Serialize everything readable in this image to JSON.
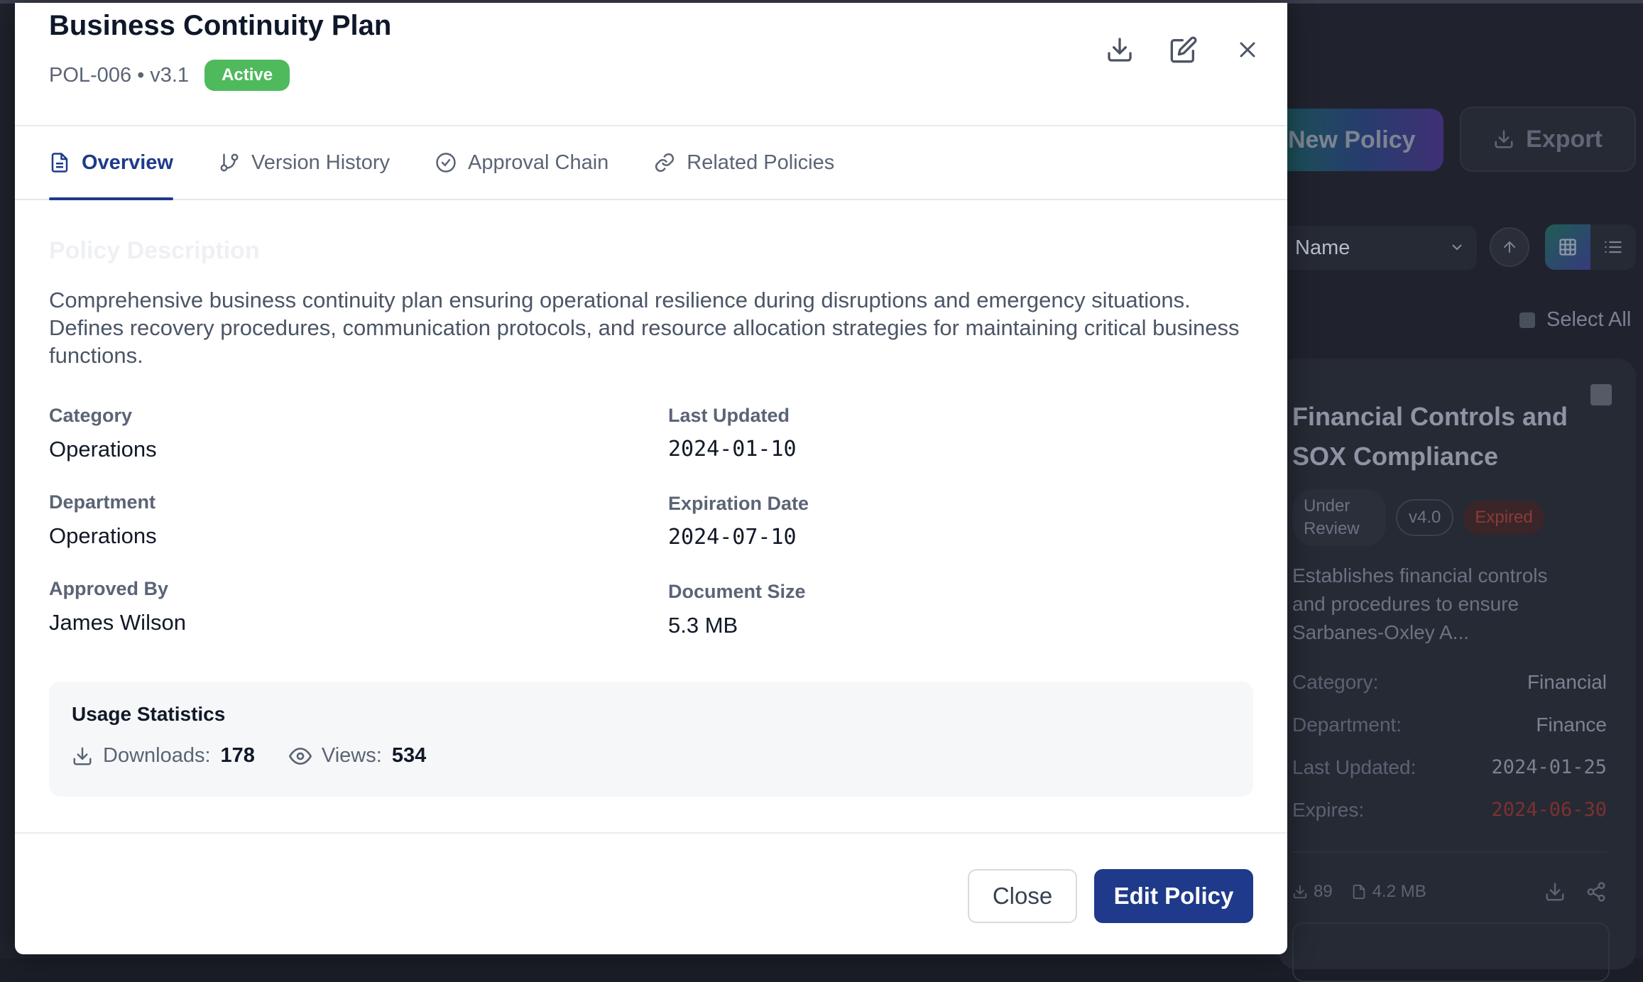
{
  "background": {
    "new_policy_label": "New Policy",
    "export_label": "Export",
    "sort_value": "Name",
    "select_all_label": "Select All",
    "card": {
      "title": "Financial Controls and SOX Compliance",
      "status": "Under Review",
      "version": "v4.0",
      "expiry_badge": "Expired",
      "description": "Establishes financial controls and procedures to ensure Sarbanes-Oxley A...",
      "meta": [
        {
          "label": "Category:",
          "value": "Financial"
        },
        {
          "label": "Department:",
          "value": "Finance"
        },
        {
          "label": "Last Updated:",
          "value": "2024-01-25"
        },
        {
          "label": "Expires:",
          "value": "2024-06-30"
        }
      ],
      "downloads": "89",
      "size": "4.2 MB"
    }
  },
  "modal": {
    "title": "Business Continuity Plan",
    "policy_id": "POL-006",
    "separator": "•",
    "version": "v3.1",
    "status": "Active",
    "status_color": "#4fba5c",
    "tabs": [
      {
        "label": "Overview",
        "icon": "document-icon",
        "active": true
      },
      {
        "label": "Version History",
        "icon": "git-branch-icon",
        "active": false
      },
      {
        "label": "Approval Chain",
        "icon": "check-circle-icon",
        "active": false
      },
      {
        "label": "Related Policies",
        "icon": "link-icon",
        "active": false
      }
    ],
    "section_title": "Policy Description",
    "description": "Comprehensive business continuity plan ensuring operational resilience during disruptions and emergency situations. Defines recovery procedures, communication protocols, and resource allocation strategies for maintaining critical business functions.",
    "fields_left": [
      {
        "label": "Category",
        "value": "Operations"
      },
      {
        "label": "Department",
        "value": "Operations"
      },
      {
        "label": "Approved By",
        "value": "James Wilson"
      }
    ],
    "fields_right": [
      {
        "label": "Last Updated",
        "value": "2024-01-10"
      },
      {
        "label": "Expiration Date",
        "value": "2024-07-10"
      },
      {
        "label": "Document Size",
        "value": "5.3 MB"
      }
    ],
    "usage": {
      "title": "Usage Statistics",
      "downloads_label": "Downloads:",
      "downloads_value": "178",
      "views_label": "Views:",
      "views_value": "534"
    },
    "footer": {
      "close_label": "Close",
      "edit_label": "Edit Policy"
    },
    "accent_color": "#1f3a8a"
  }
}
